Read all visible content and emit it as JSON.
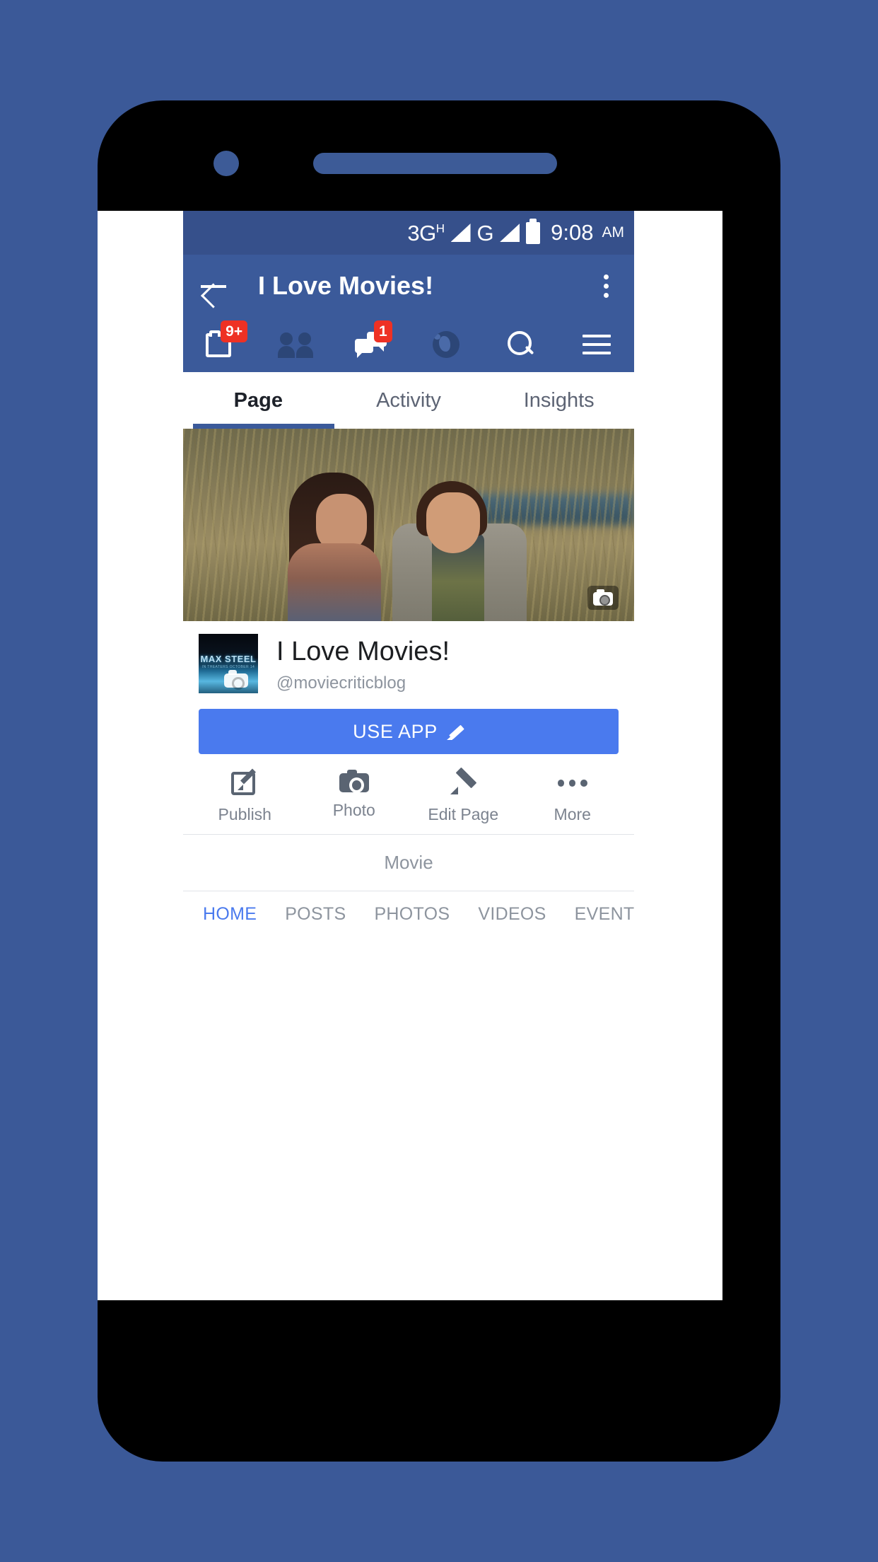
{
  "statusbar": {
    "network_primary": "3G",
    "network_primary_sup": "H",
    "network_secondary": "G",
    "time": "9:08",
    "ampm": "AM",
    "battery_icon": "battery-full-icon",
    "signal_icon": "signal-bars-icon"
  },
  "appbar": {
    "back_icon": "back-arrow-icon",
    "title": "I Love Movies!",
    "overflow_icon": "overflow-menu-icon"
  },
  "navrow": {
    "items": [
      {
        "name": "news-feed",
        "icon": "news-feed-icon",
        "badge": "9+"
      },
      {
        "name": "friend-requests",
        "icon": "friends-icon",
        "badge": ""
      },
      {
        "name": "messages",
        "icon": "messenger-icon",
        "badge": "1"
      },
      {
        "name": "notifications",
        "icon": "globe-icon",
        "badge": ""
      },
      {
        "name": "search",
        "icon": "search-icon",
        "badge": ""
      },
      {
        "name": "more-menu",
        "icon": "hamburger-menu-icon",
        "badge": ""
      }
    ]
  },
  "toptabs": {
    "items": [
      {
        "label": "Page",
        "active": true
      },
      {
        "label": "Activity",
        "active": false
      },
      {
        "label": "Insights",
        "active": false
      }
    ]
  },
  "cover": {
    "camera_icon": "camera-icon",
    "alt": "cover-photo"
  },
  "profile": {
    "avatar_title": "MAX STEEL",
    "avatar_subtitle": "IN THEATERS OCTOBER 14",
    "avatar_camera_icon": "camera-icon",
    "page_name": "I Love Movies!",
    "handle": "@moviecriticblog"
  },
  "cta": {
    "label": "USE APP",
    "icon": "pencil-icon",
    "color": "#4a7aee"
  },
  "actions": [
    {
      "label": "Publish",
      "icon": "publish-icon"
    },
    {
      "label": "Photo",
      "icon": "camera-icon"
    },
    {
      "label": "Edit Page",
      "icon": "pencil-icon"
    },
    {
      "label": "More",
      "icon": "more-dots-icon"
    }
  ],
  "category": {
    "label": "Movie"
  },
  "bottomtabs": {
    "items": [
      {
        "label": "HOME",
        "active": true
      },
      {
        "label": "POSTS",
        "active": false
      },
      {
        "label": "PHOTOS",
        "active": false
      },
      {
        "label": "VIDEOS",
        "active": false
      },
      {
        "label": "EVENTS",
        "active": false
      }
    ]
  },
  "colors": {
    "page_background": "#3b5998",
    "appbar": "#3b5a9a",
    "statusbar": "#36508b",
    "accent_blue": "#4a7aee",
    "badge_red": "#ee3124"
  }
}
